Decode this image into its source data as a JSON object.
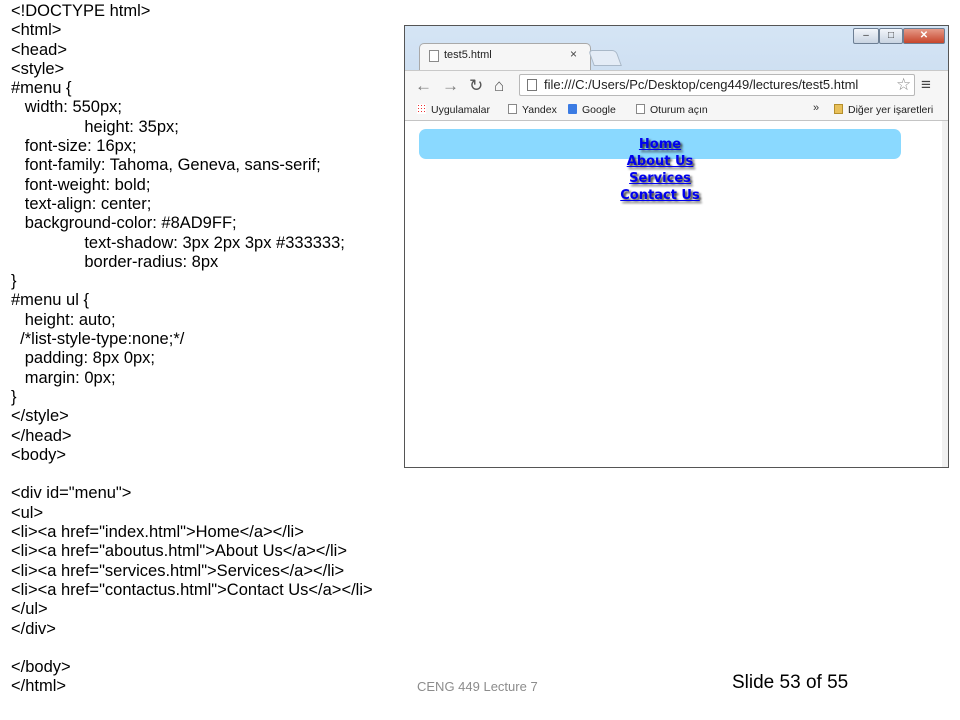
{
  "code_lines": [
    "<!DOCTYPE html>",
    "<html>",
    "<head>",
    "<style>",
    "#menu {",
    "   width: 550px;",
    "                height: 35px;",
    "   font-size: 16px;",
    "   font-family: Tahoma, Geneva, sans-serif;",
    "   font-weight: bold;",
    "   text-align: center;",
    "   background-color: #8AD9FF;",
    "                text-shadow: 3px 2px 3px #333333;",
    "                border-radius: 8px",
    "}",
    "#menu ul {",
    "   height: auto;",
    "  /*list-style-type:none;*/",
    "   padding: 8px 0px;",
    "   margin: 0px;",
    "}",
    "</style>",
    "</head>",
    "<body>",
    "",
    "<div id=\"menu\">",
    "<ul>",
    "<li><a href=\"index.html\">Home</a></li>",
    "<li><a href=\"aboutus.html\">About Us</a></li>",
    "<li><a href=\"services.html\">Services</a></li>",
    "<li><a href=\"contactus.html\">Contact Us</a></li>",
    "</ul>",
    "</div>",
    "",
    "</body>",
    "</html>"
  ],
  "footer": {
    "course": "CENG 449 Lecture 7",
    "slide": "Slide 53 of 55"
  },
  "browser": {
    "tab_title": "test5.html",
    "tab_close": "×",
    "window_buttons": {
      "minimize": "–",
      "maximize": "□",
      "close": "✕"
    },
    "url": "file:///C:/Users/Pc/Desktop/ceng449/lectures/test5.html",
    "bookmarks": [
      "Uygulamalar",
      "Yandex",
      "Google",
      "Oturum açın"
    ],
    "bookmarks_more": "»",
    "other_bookmarks": "Diğer yer işaretleri",
    "menu_links": [
      "Home",
      "About Us",
      "Services",
      "Contact Us"
    ],
    "menu_bg_color": "#8AD9FF"
  },
  "icons": {
    "back": "back-arrow-icon",
    "forward": "forward-arrow-icon",
    "reload": "reload-icon",
    "home": "home-icon",
    "bookmark_star": "star-icon",
    "chrome_menu": "hamburger-menu-icon"
  }
}
